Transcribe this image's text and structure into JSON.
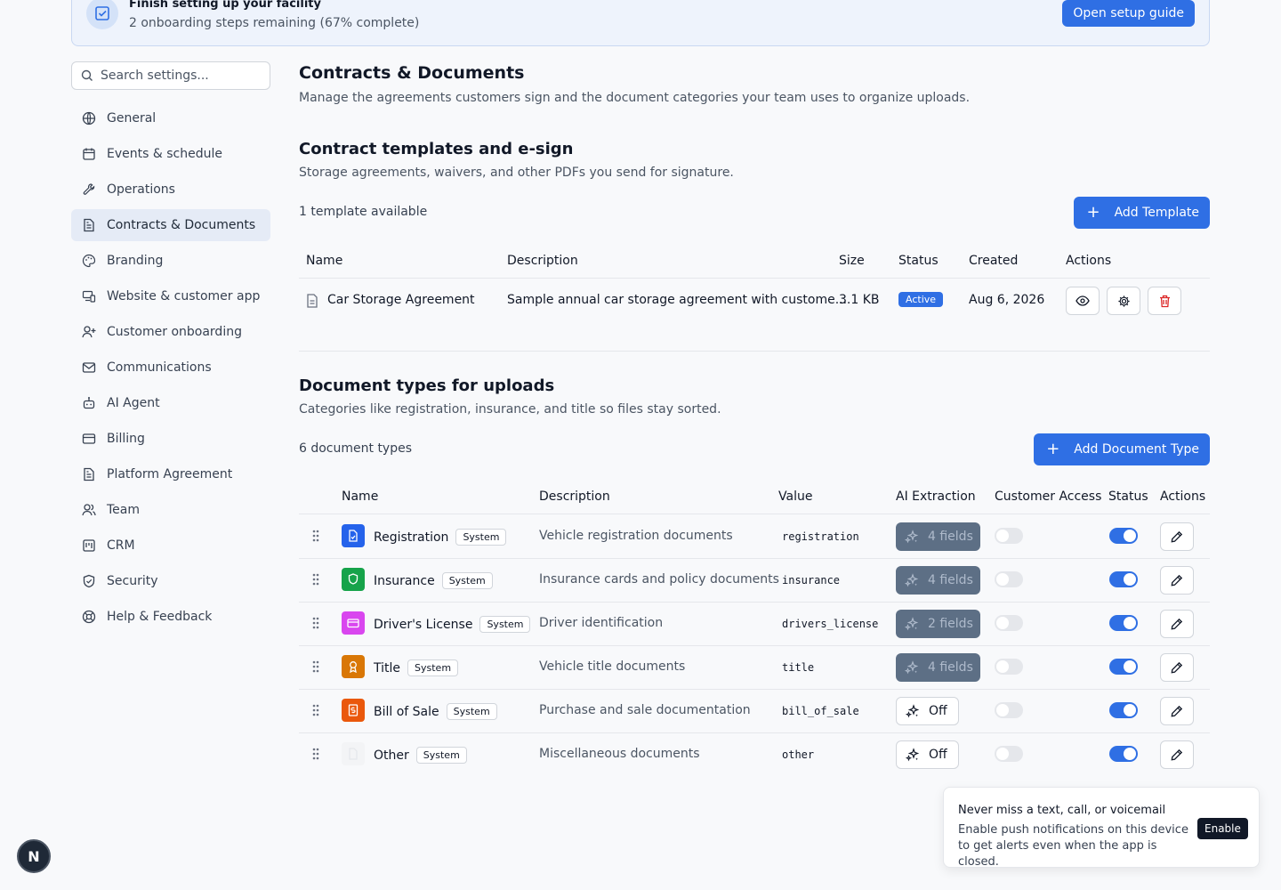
{
  "banner": {
    "title": "Finish setting up your facility",
    "subtitle": "2 onboarding steps remaining (67% complete)",
    "progress_percent": 67,
    "button": "Open setup guide"
  },
  "search": {
    "placeholder": "Search settings..."
  },
  "sidebar": {
    "items": [
      {
        "label": "General",
        "icon": "globe-icon"
      },
      {
        "label": "Events & schedule",
        "icon": "calendar-icon"
      },
      {
        "label": "Operations",
        "icon": "wrench-icon"
      },
      {
        "label": "Contracts & Documents",
        "icon": "document-icon",
        "active": true
      },
      {
        "label": "Branding",
        "icon": "palette-icon"
      },
      {
        "label": "Website & customer app",
        "icon": "devices-icon"
      },
      {
        "label": "Customer onboarding",
        "icon": "user-plus-icon"
      },
      {
        "label": "Communications",
        "icon": "mail-icon"
      },
      {
        "label": "AI Agent",
        "icon": "bot-icon"
      },
      {
        "label": "Billing",
        "icon": "credit-card-icon"
      },
      {
        "label": "Platform Agreement",
        "icon": "document-icon"
      },
      {
        "label": "Team",
        "icon": "users-icon"
      },
      {
        "label": "CRM",
        "icon": "crm-icon"
      },
      {
        "label": "Security",
        "icon": "shield-icon"
      },
      {
        "label": "Help & Feedback",
        "icon": "lifebuoy-icon"
      }
    ]
  },
  "page": {
    "title": "Contracts & Documents",
    "subtitle": "Manage the agreements customers sign and the document categories your team uses to organize uploads."
  },
  "templates": {
    "title": "Contract templates and e-sign",
    "subtitle": "Storage agreements, waivers, and other PDFs you send for signature.",
    "count": "1 template available",
    "add_button": "Add Template",
    "columns": [
      "Name",
      "Description",
      "Size",
      "Status",
      "Created",
      "Actions"
    ],
    "rows": [
      {
        "name": "Car Storage Agreement",
        "description": "Sample annual car storage agreement with custome...",
        "size": "3.1 KB",
        "status": "Active",
        "created": "Aug 6, 2026"
      }
    ]
  },
  "doc_types": {
    "title": "Document types for uploads",
    "subtitle": "Categories like registration, insurance, and title so files stay sorted.",
    "count": "6 document types",
    "add_button": "Add Document Type",
    "columns": [
      "Name",
      "Description",
      "Value",
      "AI Extraction",
      "Customer Access",
      "Status",
      "Actions"
    ],
    "rows": [
      {
        "name": "Registration",
        "badge": "System",
        "description": "Vehicle registration documents",
        "value": "registration",
        "ai": "4 fields",
        "ai_on": true,
        "customer_access": false,
        "status": true,
        "icon": "file-check-icon",
        "color": "#2563eb"
      },
      {
        "name": "Insurance",
        "badge": "System",
        "description": "Insurance cards and policy documents",
        "value": "insurance",
        "ai": "4 fields",
        "ai_on": true,
        "customer_access": false,
        "status": true,
        "icon": "shield-icon",
        "color": "#16a34a"
      },
      {
        "name": "Driver's License",
        "badge": "System",
        "description": "Driver identification",
        "value": "drivers_license",
        "ai": "2 fields",
        "ai_on": true,
        "customer_access": false,
        "status": true,
        "icon": "id-card-icon",
        "color": "#d946ef"
      },
      {
        "name": "Title",
        "badge": "System",
        "description": "Vehicle title documents",
        "value": "title",
        "ai": "4 fields",
        "ai_on": true,
        "customer_access": false,
        "status": true,
        "icon": "award-icon",
        "color": "#d97706"
      },
      {
        "name": "Bill of Sale",
        "badge": "System",
        "description": "Purchase and sale documentation",
        "value": "bill_of_sale",
        "ai": "Off",
        "ai_on": false,
        "customer_access": false,
        "status": true,
        "icon": "receipt-icon",
        "color": "#ea580c"
      },
      {
        "name": "Other",
        "badge": "System",
        "description": "Miscellaneous documents",
        "value": "other",
        "ai": "Off",
        "ai_on": false,
        "customer_access": false,
        "status": true,
        "icon": "file-icon",
        "color": "#f3f4f6"
      }
    ]
  },
  "toast": {
    "title": "Never miss a text, call, or voicemail",
    "body": "Enable push notifications on this device to get alerts even when the app is closed.",
    "button": "Enable"
  },
  "avatar": {
    "letter": "N"
  }
}
